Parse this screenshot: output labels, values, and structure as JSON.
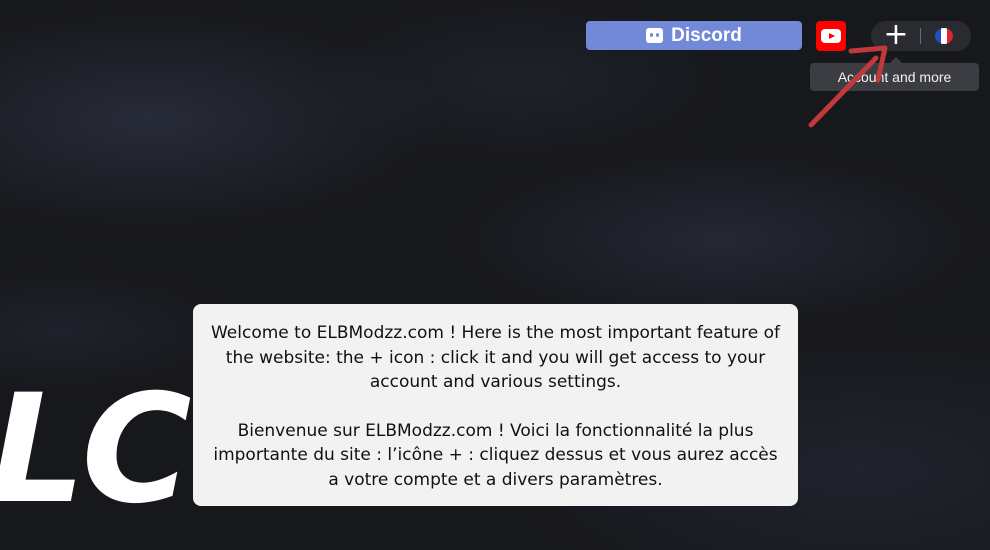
{
  "background": {
    "hero_text": "LCOME"
  },
  "header": {
    "discord_label": "Discord",
    "youtube_icon": "youtube-icon",
    "plus_icon": "+",
    "language_flag": "fr",
    "tooltip": "Account and more"
  },
  "colors": {
    "discord": "#7289da",
    "youtube": "#ff0000",
    "annotation_arrow": "#c0393b",
    "modal_bg": "#f2f2f2"
  },
  "modal": {
    "text_en": "Welcome to ELBModzz.com ! Here is the most important feature of the website: the + icon : click it and you will get access to your account and various settings.",
    "text_fr": "Bienvenue sur ELBModzz.com ! Voici la fonctionnalité la plus importante du site : l’icône + : cliquez dessus et vous aurez accès a votre compte et a divers paramètres."
  }
}
